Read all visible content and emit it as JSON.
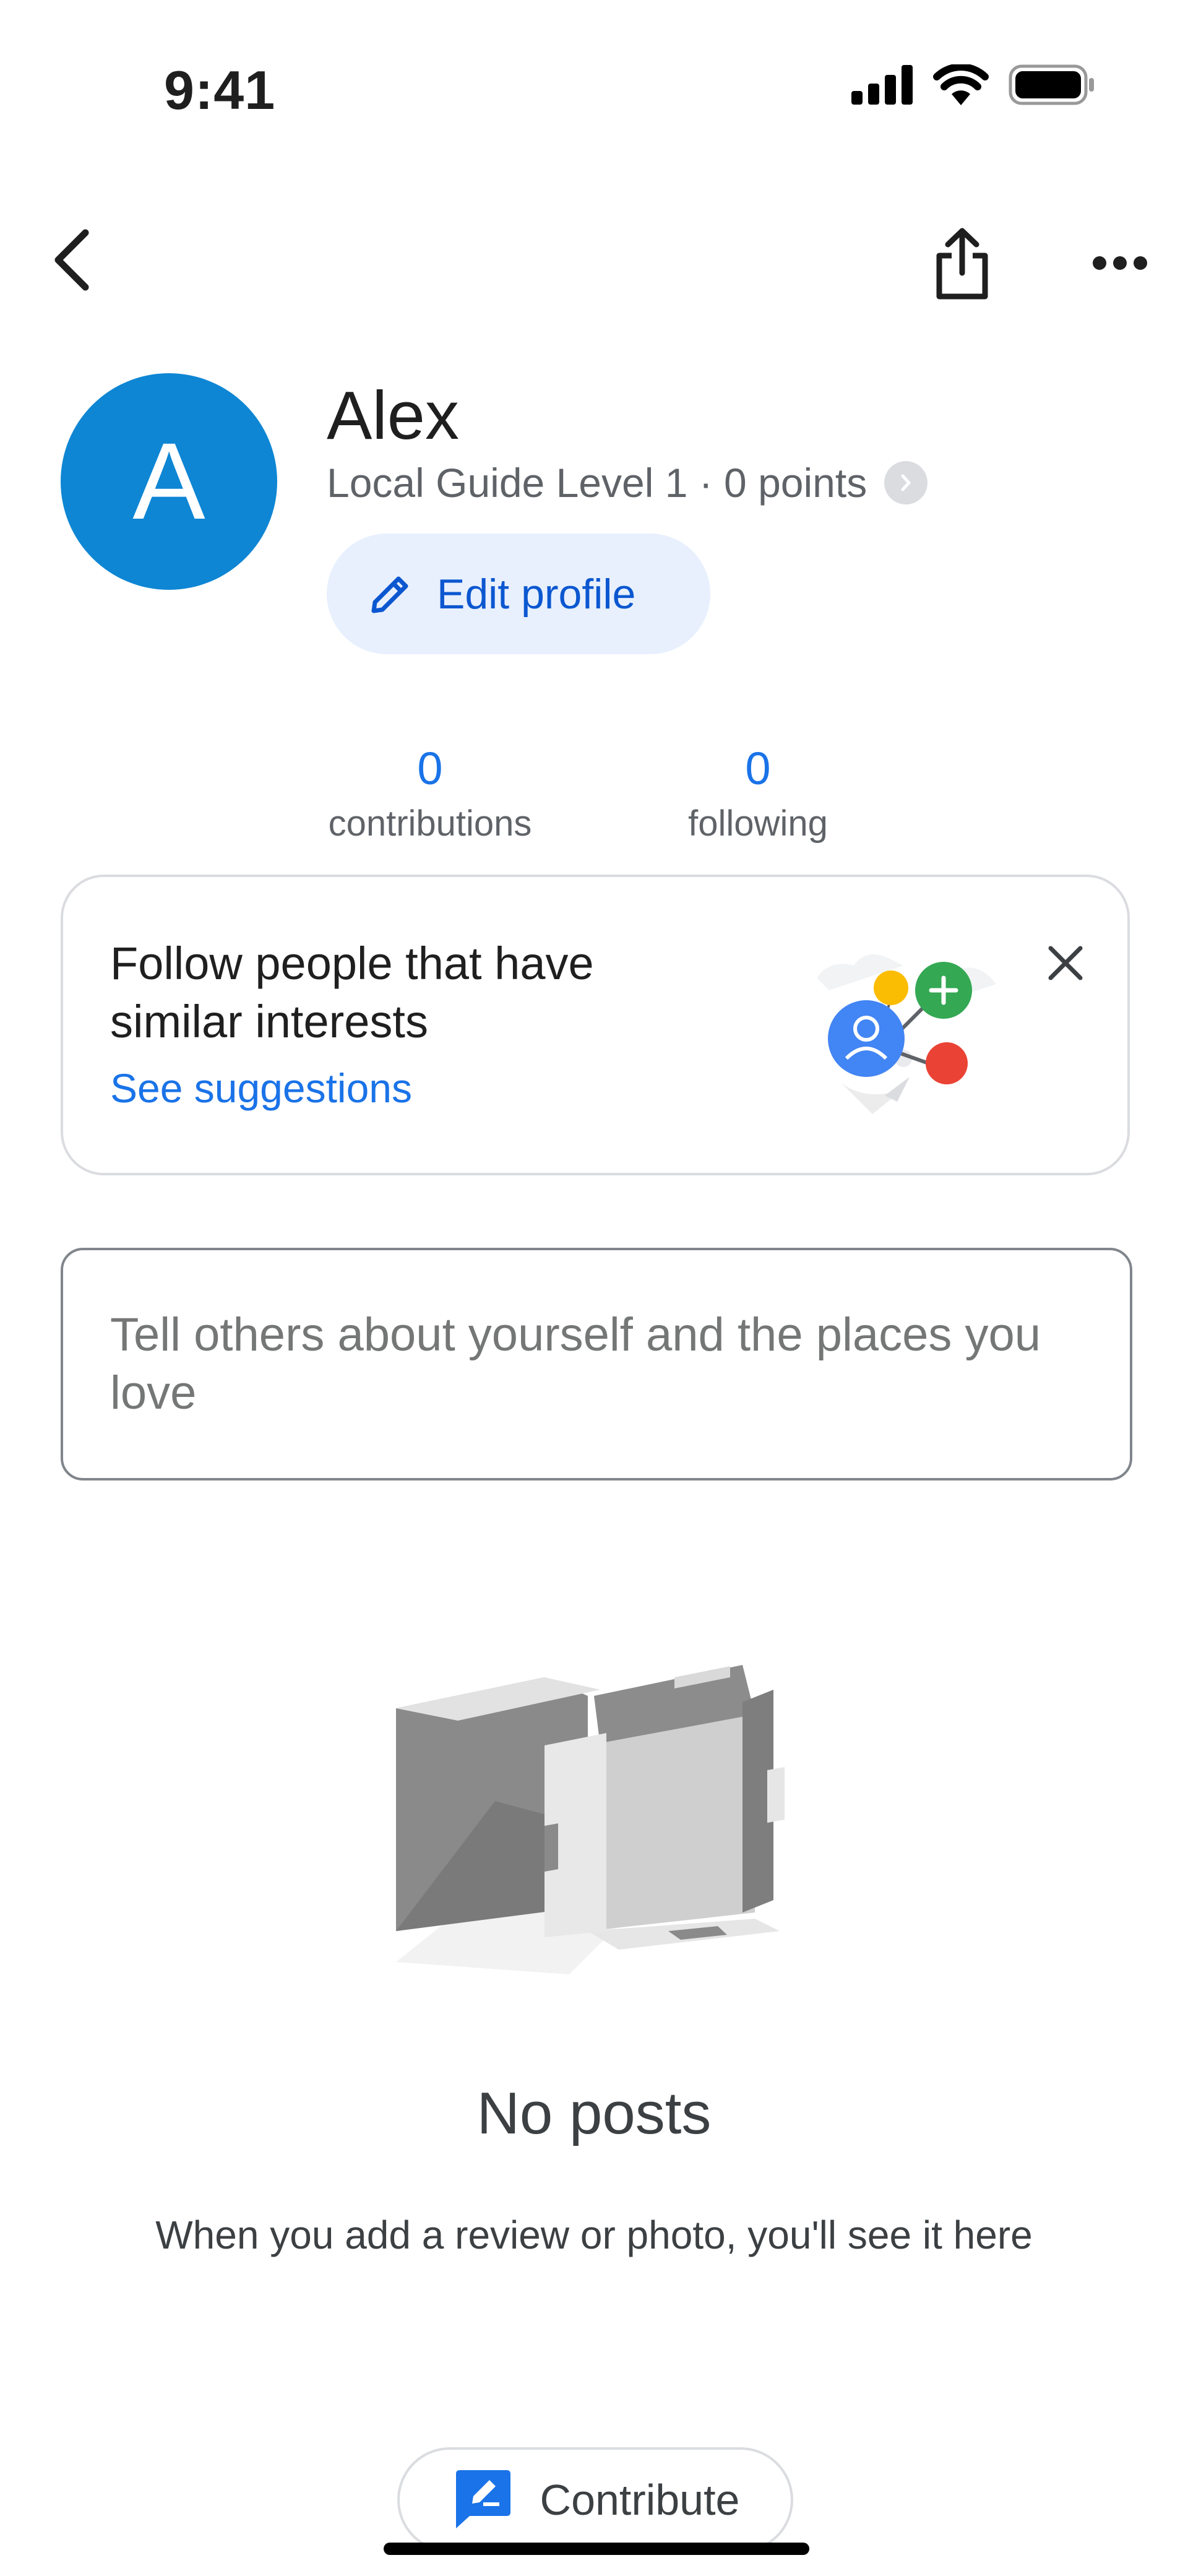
{
  "status_bar": {
    "time": "9:41",
    "icons": [
      "cellular-signal-icon",
      "wifi-icon",
      "battery-icon"
    ]
  },
  "nav": {
    "icons": [
      "back-arrow-icon",
      "share-icon",
      "more-options-icon"
    ]
  },
  "profile": {
    "avatar_letter": "A",
    "avatar_color": "#0e86d4",
    "name": "Alex",
    "level_text": "Local Guide Level 1 · 0 points",
    "edit_label": "Edit profile"
  },
  "stats": {
    "contributions": {
      "value": "0",
      "label": "contributions"
    },
    "following": {
      "value": "0",
      "label": "following"
    }
  },
  "follow_card": {
    "title": "Follow people that have similar interests",
    "link": "See suggestions"
  },
  "about": {
    "placeholder": "Tell others about yourself and the places you love"
  },
  "empty_state": {
    "title": "No posts",
    "description": "When you add a review or photo, you'll see it here"
  },
  "contribute": {
    "label": "Contribute"
  },
  "colors": {
    "accent_blue": "#1a73e8",
    "button_blue": "#0b57d0",
    "edit_bg": "#e8f0fe"
  }
}
